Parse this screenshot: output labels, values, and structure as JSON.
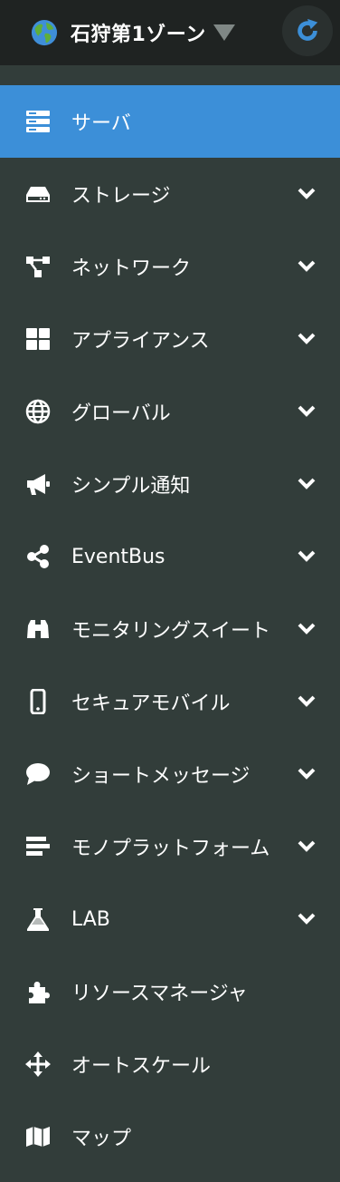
{
  "header": {
    "zone_name": "石狩第1ゾーン",
    "zone_icon": "globe-icon",
    "refresh_icon": "refresh-icon"
  },
  "colors": {
    "sidebar_bg": "#323d3a",
    "topbar_bg": "#1f2322",
    "active_bg": "#3c8fd8",
    "refresh_accent": "#3c8fd8"
  },
  "menu": {
    "items": [
      {
        "label": "サーバ",
        "icon": "server-icon",
        "expandable": false,
        "active": true
      },
      {
        "label": "ストレージ",
        "icon": "hdd-icon",
        "expandable": true,
        "active": false
      },
      {
        "label": "ネットワーク",
        "icon": "network-icon",
        "expandable": true,
        "active": false
      },
      {
        "label": "アプライアンス",
        "icon": "th-large-icon",
        "expandable": true,
        "active": false
      },
      {
        "label": "グローバル",
        "icon": "globe-grid-icon",
        "expandable": true,
        "active": false
      },
      {
        "label": "シンプル通知",
        "icon": "bullhorn-icon",
        "expandable": true,
        "active": false
      },
      {
        "label": "EventBus",
        "icon": "share-alt-icon",
        "expandable": true,
        "active": false
      },
      {
        "label": "モニタリングスイート",
        "icon": "binoculars-icon",
        "expandable": true,
        "active": false
      },
      {
        "label": "セキュアモバイル",
        "icon": "mobile-icon",
        "expandable": true,
        "active": false
      },
      {
        "label": "ショートメッセージ",
        "icon": "comment-icon",
        "expandable": true,
        "active": false
      },
      {
        "label": "モノプラットフォーム",
        "icon": "layers-icon",
        "expandable": true,
        "active": false
      },
      {
        "label": "LAB",
        "icon": "flask-icon",
        "expandable": true,
        "active": false
      },
      {
        "label": "リソースマネージャ",
        "icon": "puzzle-icon",
        "expandable": false,
        "active": false
      },
      {
        "label": "オートスケール",
        "icon": "arrows-icon",
        "expandable": false,
        "active": false
      },
      {
        "label": "マップ",
        "icon": "map-icon",
        "expandable": false,
        "active": false
      }
    ]
  }
}
